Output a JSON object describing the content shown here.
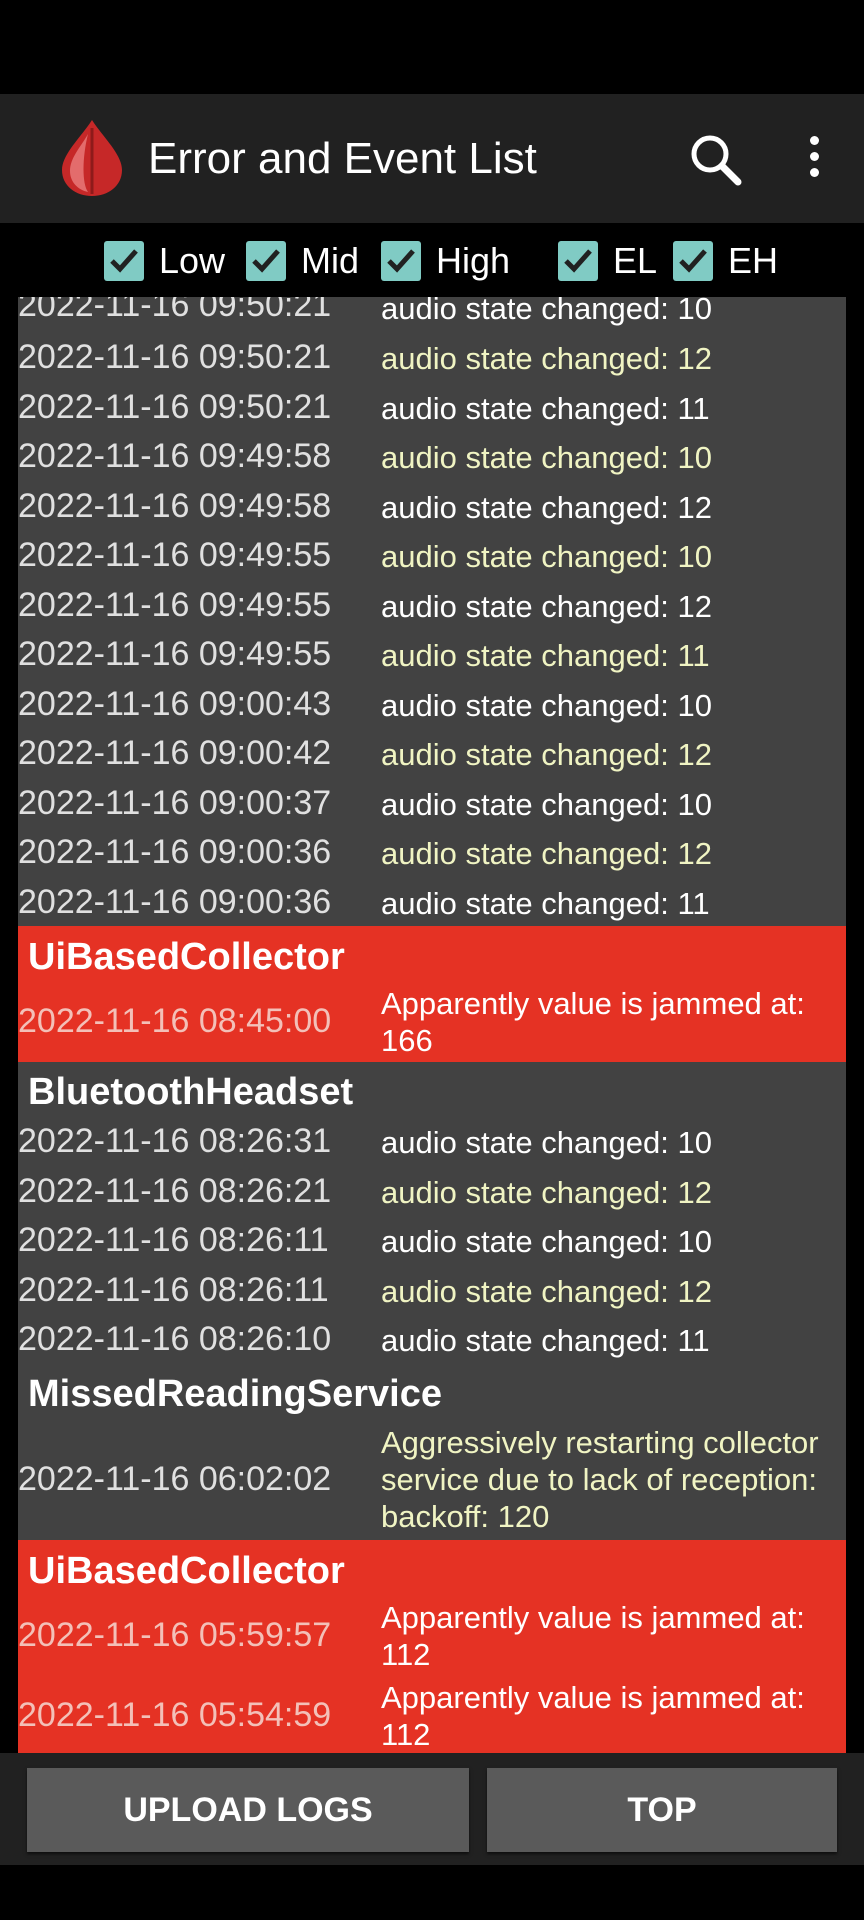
{
  "app_bar": {
    "title": "Error and Event List",
    "logo_icon": "blood-drop-icon",
    "search_icon": "search-icon",
    "menu_icon": "more-vert-icon"
  },
  "filters": [
    {
      "label": "Low",
      "checked": true
    },
    {
      "label": "Mid",
      "checked": true
    },
    {
      "label": "High",
      "checked": true
    },
    {
      "label": "EL",
      "checked": true
    },
    {
      "label": "EH",
      "checked": true
    }
  ],
  "log": {
    "partial_top": {
      "time": "2022-11-16 09:50:21",
      "message": "audio state changed: 10"
    },
    "group1_rows": [
      {
        "time": "2022-11-16 09:50:21",
        "message": "audio state changed: 12"
      },
      {
        "time": "2022-11-16 09:50:21",
        "message": "audio state changed: 11"
      },
      {
        "time": "2022-11-16 09:49:58",
        "message": "audio state changed: 10"
      },
      {
        "time": "2022-11-16 09:49:58",
        "message": "audio state changed: 12"
      },
      {
        "time": "2022-11-16 09:49:55",
        "message": "audio state changed: 10"
      },
      {
        "time": "2022-11-16 09:49:55",
        "message": "audio state changed: 12"
      },
      {
        "time": "2022-11-16 09:49:55",
        "message": "audio state changed: 11"
      },
      {
        "time": "2022-11-16 09:00:43",
        "message": "audio state changed: 10"
      },
      {
        "time": "2022-11-16 09:00:42",
        "message": "audio state changed: 12"
      },
      {
        "time": "2022-11-16 09:00:37",
        "message": "audio state changed: 10"
      },
      {
        "time": "2022-11-16 09:00:36",
        "message": "audio state changed: 12"
      },
      {
        "time": "2022-11-16 09:00:36",
        "message": "audio state changed: 11"
      }
    ],
    "group2": {
      "header": "UiBasedCollector",
      "rows": [
        {
          "time": "2022-11-16 08:45:00",
          "message": "Apparently value is jammed at: 166"
        }
      ]
    },
    "group3": {
      "header": "BluetoothHeadset",
      "rows": [
        {
          "time": "2022-11-16 08:26:31",
          "message": "audio state changed: 10"
        },
        {
          "time": "2022-11-16 08:26:21",
          "message": "audio state changed: 12"
        },
        {
          "time": "2022-11-16 08:26:11",
          "message": "audio state changed: 10"
        },
        {
          "time": "2022-11-16 08:26:11",
          "message": "audio state changed: 12"
        },
        {
          "time": "2022-11-16 08:26:10",
          "message": "audio state changed: 11"
        }
      ]
    },
    "group4": {
      "header": "MissedReadingService",
      "rows": [
        {
          "time": "2022-11-16 06:02:02",
          "message": "Aggressively restarting collector service due to lack of reception: backoff: 120"
        }
      ]
    },
    "group5": {
      "header": "UiBasedCollector",
      "rows": [
        {
          "time": "2022-11-16 05:59:57",
          "message": "Apparently value is jammed at: 112"
        },
        {
          "time": "2022-11-16 05:54:59",
          "message": "Apparently value is jammed at: 112"
        }
      ]
    }
  },
  "buttons": {
    "upload": "UPLOAD LOGS",
    "top": "TOP"
  },
  "colors": {
    "error_red": "#e53224",
    "list_bg": "#424242",
    "checkbox_teal": "#80cbc4",
    "alt_text": "#f0f4c3"
  }
}
